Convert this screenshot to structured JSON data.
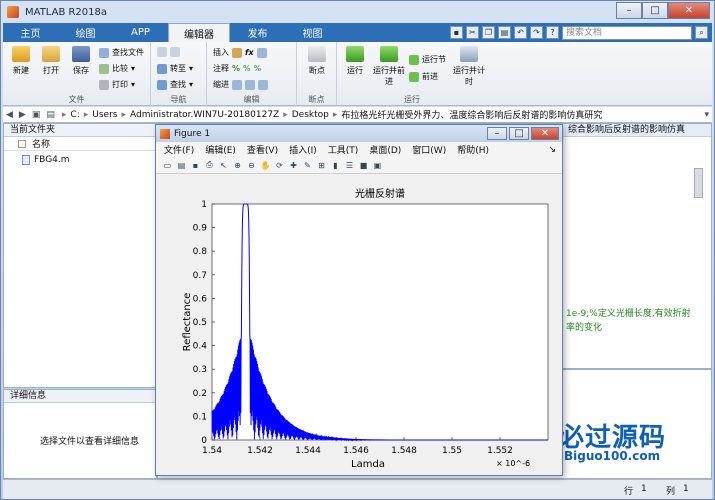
{
  "app": {
    "title": "MATLAB R2018a"
  },
  "tabs": [
    "主页",
    "绘图",
    "APP",
    "编辑器",
    "发布",
    "视图"
  ],
  "search": {
    "placeholder": "搜索文档"
  },
  "ribbon": {
    "groups": [
      {
        "label": "文件"
      },
      {
        "label": "导航"
      },
      {
        "label": "编辑"
      },
      {
        "label": "断点"
      },
      {
        "label": "运行"
      }
    ],
    "file": {
      "new": "新建",
      "open": "打开",
      "save": "保存",
      "find_files": "查找文件",
      "compare": "比较",
      "print": "打印"
    },
    "nav": {
      "goto": "转至",
      "find": "查找"
    },
    "edit": {
      "insert": "插入",
      "comment": "注释",
      "indent": "缩进"
    },
    "breakpoints": {
      "label": "断点"
    },
    "run": {
      "run": "运行",
      "run_advance": "运行并前进",
      "run_section": "运行节",
      "advance": "前进",
      "run_time": "运行并计时"
    }
  },
  "path": {
    "parts": [
      "C:",
      "Users",
      "Administrator.WIN7U-20180127Z",
      "Desktop",
      "布拉格光纤光栅受外界力、温度综合影响后反射谱的影响仿真研究"
    ]
  },
  "current_folder": {
    "title": "当前文件夹",
    "column": "名称",
    "files": [
      "FBG4.m"
    ]
  },
  "details": {
    "title": "详细信息",
    "message": "选择文件以查看详细信息"
  },
  "editor_snippets": {
    "tab_title": "综合影响后反射谱的影响仿真",
    "line1": "1e-9;%定义光栅长度,有效折射",
    "line2": "率的变化"
  },
  "figure": {
    "title": "Figure 1",
    "menus": [
      "文件(F)",
      "编辑(E)",
      "查看(V)",
      "插入(I)",
      "工具(T)",
      "桌面(D)",
      "窗口(W)",
      "帮助(H)"
    ]
  },
  "chart_data": {
    "type": "line",
    "title": "光栅反射谱",
    "xlabel": "Lamda",
    "ylabel": "Reflectance",
    "x_multiplier": "× 10^-6",
    "xlim": [
      1.54,
      1.554
    ],
    "ylim": [
      0,
      1
    ],
    "xticks": [
      "1.54",
      "1.542",
      "1.544",
      "1.546",
      "1.548",
      "1.55",
      "1.552"
    ],
    "yticks": [
      "0",
      "0.1",
      "0.2",
      "0.3",
      "0.4",
      "0.5",
      "0.6",
      "0.7",
      "0.8",
      "0.9",
      "1"
    ],
    "peak_center": 1.5414,
    "peak_width": 0.00018,
    "sidelobe_width": 0.0011,
    "series": [
      {
        "color": "#0000ff"
      }
    ]
  },
  "status": {
    "line_label": "行",
    "line_value": "1",
    "col_label": "列",
    "col_value": "1"
  },
  "watermark": {
    "text": "必过源码",
    "url": "Biguo100.com"
  }
}
